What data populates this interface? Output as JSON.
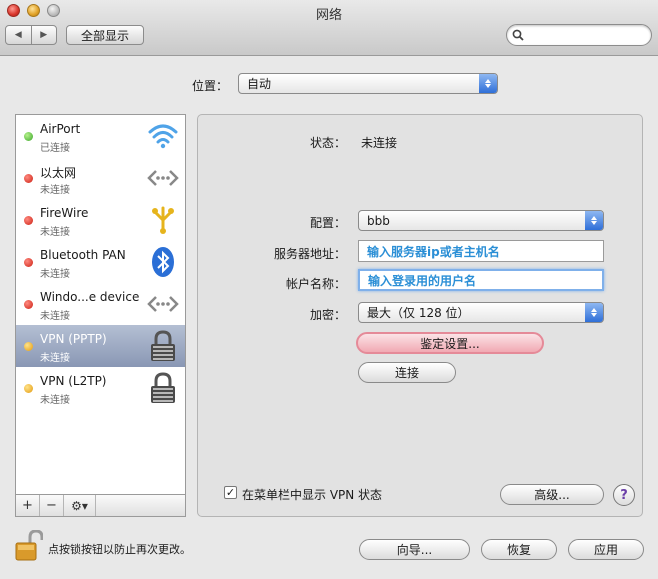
{
  "window": {
    "title": "网络"
  },
  "toolbar": {
    "back": "◀",
    "forward": "▶",
    "show_all": "全部显示",
    "search_placeholder": ""
  },
  "location": {
    "label": "位置：",
    "value": "自动"
  },
  "sidebar": {
    "items": [
      {
        "name": "AirPort",
        "status": "已连接",
        "dot": "green",
        "icon": "wifi-icon"
      },
      {
        "name": "以太网",
        "status": "未连接",
        "dot": "red",
        "icon": "ethernet-icon"
      },
      {
        "name": "FireWire",
        "status": "未连接",
        "dot": "red",
        "icon": "firewire-icon"
      },
      {
        "name": "Bluetooth PAN",
        "status": "未连接",
        "dot": "red",
        "icon": "bluetooth-icon"
      },
      {
        "name": "Windo...e device",
        "status": "未连接",
        "dot": "red",
        "icon": "ethernet-icon"
      },
      {
        "name": "VPN (PPTP)",
        "status": "未连接",
        "dot": "yellow",
        "icon": "vpn-lock-icon",
        "selected": true
      },
      {
        "name": "VPN (L2TP)",
        "status": "未连接",
        "dot": "yellow",
        "icon": "vpn-lock-icon"
      }
    ],
    "tools": {
      "add": "+",
      "remove": "−",
      "action": "⚙▾"
    }
  },
  "detail": {
    "status_label": "状态：",
    "status_value": "未连接",
    "config_label": "配置：",
    "config_value": "bbb",
    "server_label": "服务器地址：",
    "server_value": "输入服务器ip或者主机名",
    "account_label": "帐户名称：",
    "account_value": "输入登录用的用户名",
    "encryption_label": "加密：",
    "encryption_value": "最大（仅 128 位）",
    "auth_button": "鉴定设置...",
    "connect_button": "连接",
    "show_vpn_status_label": "在菜单栏中显示 VPN 状态",
    "show_vpn_status_checked": "✓",
    "advanced_button": "高级...",
    "help_button": "?"
  },
  "footer": {
    "lock_text": "点按锁按钮以防止再次更改。",
    "assistant_button": "向导...",
    "revert_button": "恢复",
    "apply_button": "应用"
  },
  "colors": {
    "accent_blue": "#2f6fd8",
    "selection": "#8997b4",
    "typed_text": "#2b8fd6",
    "auth_highlight": "#f1a9b3"
  }
}
